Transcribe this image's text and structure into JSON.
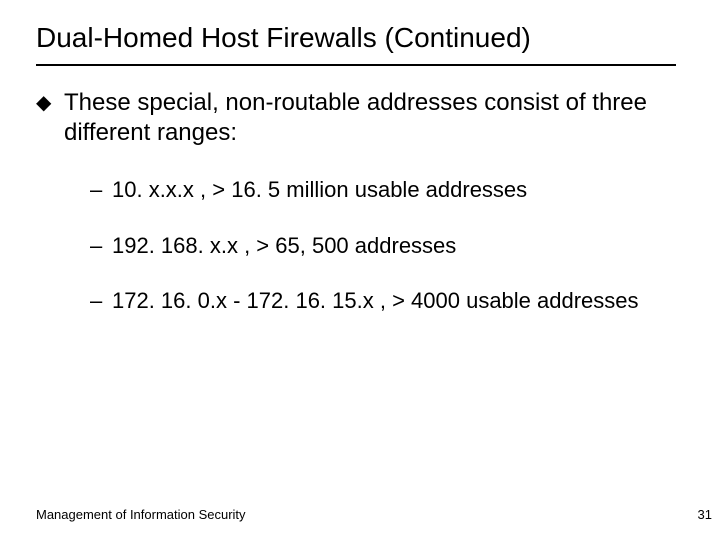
{
  "title": "Dual-Homed Host Firewalls (Continued)",
  "intro": "These special, non-routable addresses consist of three different ranges:",
  "ranges": [
    "10. x.x.x  , > 16. 5 million usable addresses",
    "192. 168. x.x , > 65, 500 addresses",
    "172. 16. 0.x - 172. 16. 15.x , > 4000 usable addresses"
  ],
  "footer": "Management of Information Security",
  "page_number": "31"
}
